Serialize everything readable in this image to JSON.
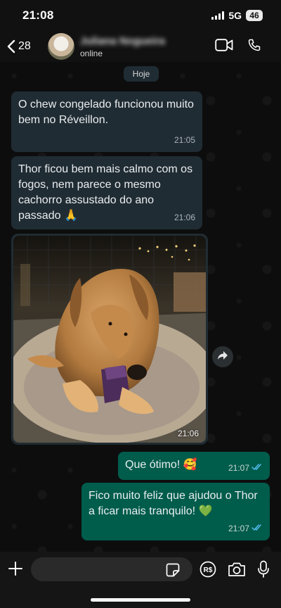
{
  "status_bar": {
    "time": "21:08",
    "network": "5G",
    "battery": "46"
  },
  "header": {
    "back_count": "28",
    "contact_name": "Juliana Nogueira",
    "contact_status": "online",
    "icons": [
      "back-chevron-icon",
      "video-call-icon",
      "phone-icon"
    ]
  },
  "chat": {
    "date_chip": "Hoje",
    "messages": [
      {
        "direction": "in",
        "text": "O chew congelado funcionou muito bem no Réveillon.",
        "time": "21:05"
      },
      {
        "direction": "in",
        "text": "Thor ficou bem mais calmo com os fogos, nem parece o mesmo cachorro assustado do ano passado 🙏",
        "time": "21:06"
      },
      {
        "direction": "in",
        "type": "image",
        "image_description": "golden retriever lying on a cushion chewing a purple frozen treat",
        "time": "21:06"
      },
      {
        "direction": "out",
        "text": "Que ótimo! 🥰",
        "time": "21:07"
      },
      {
        "direction": "out",
        "text": "Fico muito feliz que ajudou o Thor a ficar mais tranquilo! 💚",
        "time": "21:07"
      }
    ]
  },
  "composer": {
    "input_value": "",
    "icons": [
      "plus-icon",
      "sticker-icon",
      "rupee-icon",
      "camera-icon",
      "microphone-icon"
    ]
  },
  "colors": {
    "incoming_bubble": "#202c33",
    "outgoing_bubble": "#005c4b",
    "read_ticks": "#53bdeb",
    "background": "#0d0d0d"
  }
}
